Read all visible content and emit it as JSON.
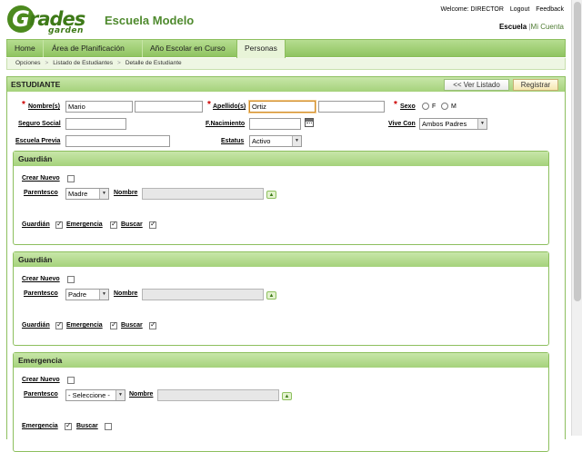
{
  "logo": {
    "letter": "G",
    "word": "rades",
    "sub": "garden"
  },
  "header": {
    "school_name": "Escuela Modelo",
    "welcome": "Welcome: DIRECTOR",
    "logout": "Logout",
    "feedback": "Feedback",
    "school": "Escuela",
    "separator": "|",
    "my_account": "Mi Cuenta"
  },
  "nav": {
    "tabs": [
      "Home",
      "Área de Planificación",
      "Año Escolar en Curso",
      "Personas"
    ],
    "active": "Personas"
  },
  "breadcrumb": [
    "Opciones",
    "Listado de Estudiantes",
    "Detalle de Estudiante"
  ],
  "student": {
    "title": "ESTUDIANTE",
    "back_button": "<< Ver Listado",
    "register_button": "Registrar",
    "labels": {
      "names": "Nombre(s)",
      "surnames": "Apellido(s)",
      "sex": "Sexo",
      "ssn": "Seguro Social",
      "birth": "F.Nacimiento",
      "lives_with": "Vive Con",
      "prev_school": "Escuela Previa",
      "status": "Estatus"
    },
    "values": {
      "first_name": "Mario",
      "middle_name": "",
      "last_name": "Ortiz",
      "second_last_name": "",
      "sex_f": "F",
      "sex_m": "M",
      "ssn": "",
      "birth": "",
      "lives_with": "Ambos Padres",
      "prev_school": "",
      "status": "Activo"
    }
  },
  "sections": [
    {
      "title": "Guardián",
      "create_new": "Crear Nuevo",
      "relation_label": "Parentesco",
      "relation_value": "Madre",
      "name_label": "Nombre",
      "name_value": "",
      "flags": [
        {
          "label": "Guardián",
          "checked": true
        },
        {
          "label": "Emergencia",
          "checked": true
        },
        {
          "label": "Buscar",
          "checked": true
        }
      ]
    },
    {
      "title": "Guardián",
      "create_new": "Crear Nuevo",
      "relation_label": "Parentesco",
      "relation_value": "Padre",
      "name_label": "Nombre",
      "name_value": "",
      "flags": [
        {
          "label": "Guardián",
          "checked": true
        },
        {
          "label": "Emergencia",
          "checked": true
        },
        {
          "label": "Buscar",
          "checked": true
        }
      ]
    },
    {
      "title": "Emergencia",
      "create_new": "Crear Nuevo",
      "relation_label": "Parentesco",
      "relation_value": "- Seleccione -",
      "name_label": "Nombre",
      "name_value": "",
      "flags": [
        {
          "label": "Emergencia",
          "checked": true
        },
        {
          "label": "Buscar",
          "checked": false
        }
      ]
    }
  ],
  "icons": {
    "calendar": "calendar-icon",
    "expand": "triangle-up-icon",
    "dropdown": "chevron-down-icon"
  },
  "colors": {
    "brand_green": "#4f8a2e",
    "header_gradient_top": "#c8e6a9",
    "header_gradient_bottom": "#a5d27b",
    "required": "#cc0000"
  }
}
